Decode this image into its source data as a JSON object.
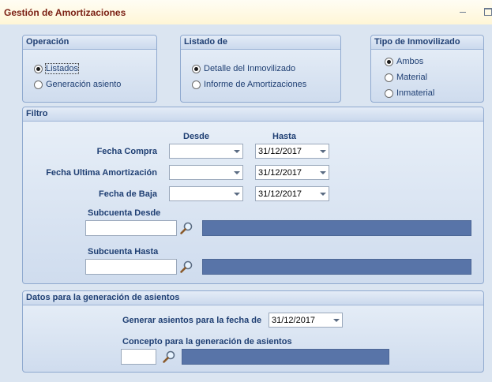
{
  "window": {
    "title": "Gestión de Amortizaciones"
  },
  "operacion": {
    "header": "Operación",
    "options": [
      {
        "label": "Listados",
        "checked": true
      },
      {
        "label": "Generación asiento",
        "checked": false
      }
    ]
  },
  "listado": {
    "header": "Listado de",
    "options": [
      {
        "label": "Detalle del Inmovilizado",
        "checked": true
      },
      {
        "label": "Informe de Amortizaciones",
        "checked": false
      }
    ]
  },
  "tipo": {
    "header": "Tipo de Inmovilizado",
    "options": [
      {
        "label": "Ambos",
        "checked": true
      },
      {
        "label": "Material",
        "checked": false
      },
      {
        "label": "Inmaterial",
        "checked": false
      }
    ]
  },
  "filtro": {
    "header": "Filtro",
    "desde_label": "Desde",
    "hasta_label": "Hasta",
    "rows": [
      {
        "label": "Fecha Compra",
        "desde": "",
        "hasta": "31/12/2017"
      },
      {
        "label": "Fecha Ultima Amortización",
        "desde": "",
        "hasta": "31/12/2017"
      },
      {
        "label": "Fecha de Baja",
        "desde": "",
        "hasta": "31/12/2017"
      }
    ],
    "subcuenta_desde_label": "Subcuenta Desde",
    "subcuenta_hasta_label": "Subcuenta Hasta",
    "subcuenta_desde_value": "",
    "subcuenta_hasta_value": ""
  },
  "asientos": {
    "header": "Datos para la generación de asientos",
    "fecha_label": "Generar asientos para la fecha de",
    "fecha_value": "31/12/2017",
    "concepto_label": "Concepto para la generación de asientos",
    "concepto_value": ""
  },
  "icons": {
    "search": "magnifier-icon",
    "dropdown": "chevron-down-icon"
  },
  "colors": {
    "title_text": "#7a1f12",
    "label_text": "#1f3f73",
    "lookup_bar": "#5874a8"
  }
}
